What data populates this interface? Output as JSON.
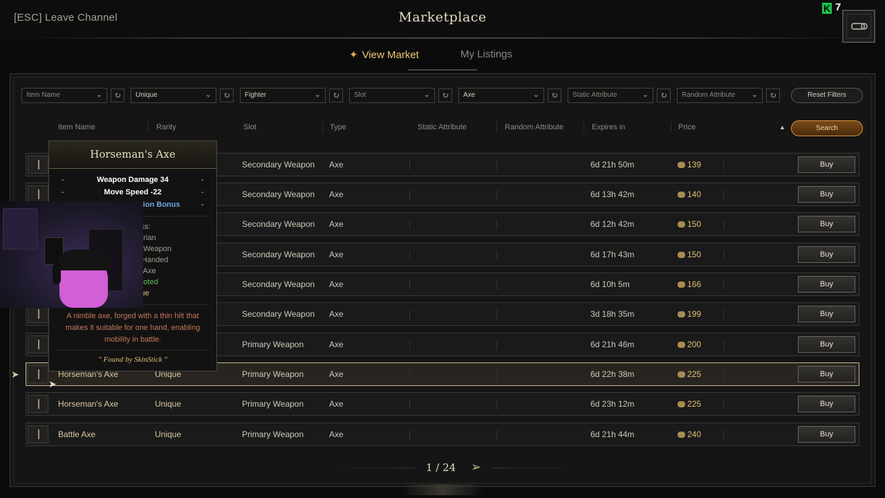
{
  "top": {
    "leave_label": "[ESC] Leave Channel",
    "title": "Marketplace",
    "k_badge": "K",
    "k_count": "7"
  },
  "tabs": {
    "view_market": "View Market",
    "my_listings": "My Listings"
  },
  "filters": {
    "item_name": "Item Name",
    "rarity": "Unique",
    "class": "Fighter",
    "slot": "Slot",
    "type": "Axe",
    "static_attribute": "Static Attribute",
    "random_attribute": "Random Attribute",
    "reset_label": "Reset Filters"
  },
  "columns": {
    "item_name": "Item Name",
    "rarity": "Rarity",
    "slot": "Slot",
    "type": "Type",
    "static_attribute": "Static Attribute",
    "random_attribute": "Random Attribute",
    "expires_in": "Expires in",
    "price": "Price",
    "search_label": "Search"
  },
  "rows": [
    {
      "name": "",
      "rarity": "",
      "slot": "Secondary Weapon",
      "type": "Axe",
      "expires": "6d 21h 50m",
      "price": "139",
      "buy": "Buy"
    },
    {
      "name": "",
      "rarity": "",
      "slot": "Secondary Weapon",
      "type": "Axe",
      "expires": "6d 13h 42m",
      "price": "140",
      "buy": "Buy"
    },
    {
      "name": "",
      "rarity": "",
      "slot": "Secondary Weapon",
      "type": "Axe",
      "expires": "6d 12h 42m",
      "price": "150",
      "buy": "Buy"
    },
    {
      "name": "",
      "rarity": "",
      "slot": "Secondary Weapon",
      "type": "Axe",
      "expires": "6d 17h 43m",
      "price": "150",
      "buy": "Buy"
    },
    {
      "name": "",
      "rarity": "",
      "slot": "Secondary Weapon",
      "type": "Axe",
      "expires": "6d 10h 5m",
      "price": "166",
      "buy": "Buy"
    },
    {
      "name": "",
      "rarity": "",
      "slot": "Secondary Weapon",
      "type": "Axe",
      "expires": "3d 18h 35m",
      "price": "199",
      "buy": "Buy"
    },
    {
      "name": "",
      "rarity": "",
      "slot": "Primary Weapon",
      "type": "Axe",
      "expires": "6d 21h 46m",
      "price": "200",
      "buy": "Buy"
    },
    {
      "name": "Horseman's Axe",
      "rarity": "Unique",
      "slot": "Primary Weapon",
      "type": "Axe",
      "expires": "6d 22h 38m",
      "price": "225",
      "buy": "Buy"
    },
    {
      "name": "Horseman's Axe",
      "rarity": "Unique",
      "slot": "Primary Weapon",
      "type": "Axe",
      "expires": "6d 23h 12m",
      "price": "225",
      "buy": "Buy"
    },
    {
      "name": "Battle Axe",
      "rarity": "Unique",
      "slot": "Primary Weapon",
      "type": "Axe",
      "expires": "6d 21h 44m",
      "price": "240",
      "buy": "Buy"
    }
  ],
  "tooltip": {
    "title": "Horseman's Axe",
    "stat1": "Weapon Damage 34",
    "stat2": "Move Speed -22",
    "stat3": "duction Bonus",
    "dash": "-",
    "req_class_label": "lass:",
    "req_class": "barian",
    "req_slot": "ry Weapon",
    "req_hand": "e-Handed",
    "req_type": "e:  Axe",
    "req_looted": "Looted",
    "req_rarity": "ique",
    "description": "A nimble axe, forged with a thin hilt that makes it suitable for one hand, enabling mobility in battle.",
    "found_by": "\" Found by SkinStick \""
  },
  "pager": {
    "page_text": "1  /  24"
  },
  "colors": {
    "accent_gold": "#f0c673",
    "panel_bg": "#151515",
    "search_orange": "#d9913a",
    "stat_blue": "#6fa5e6",
    "looted_green": "#5ac05a"
  }
}
